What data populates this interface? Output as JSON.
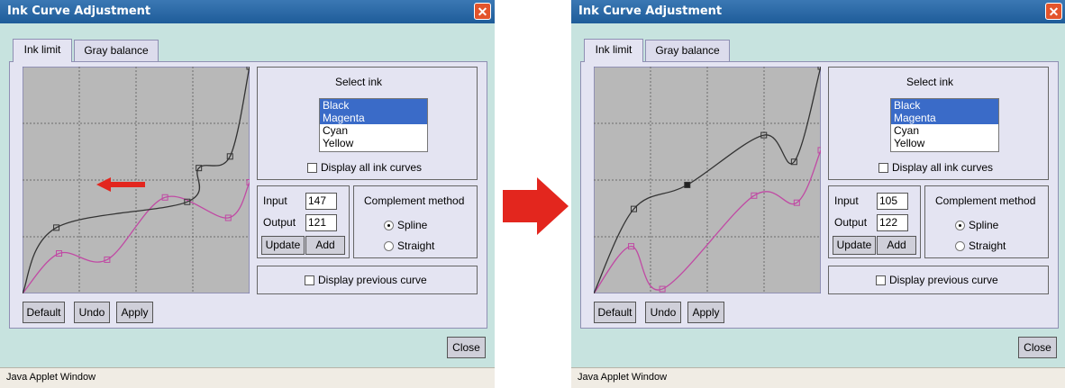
{
  "colors": {
    "window_bg": "#c7e3df",
    "title_bar": "#1e5c99",
    "panel_bg": "#e4e4f2",
    "graph_bg": "#b8b8b8",
    "black_curve": "#333333",
    "magenta_curve": "#c04aa4",
    "selection": "#3a6bc8",
    "transition_arrow": "#e3261e"
  },
  "icons": {
    "close": "close-x-icon",
    "arrow": "right-arrow-icon",
    "drag": "left-arrow-icon"
  },
  "before": {
    "title": "Ink Curve Adjustment",
    "close_glyph": "✕",
    "tabs": [
      "Ink limit",
      "Gray balance"
    ],
    "select_ink_label": "Select ink",
    "inks": [
      {
        "label": "Black",
        "selected": true
      },
      {
        "label": "Magenta",
        "selected": true
      },
      {
        "label": "Cyan",
        "selected": false
      },
      {
        "label": "Yellow",
        "selected": false
      }
    ],
    "display_all_label": "Display all ink curves",
    "input_label": "Input",
    "input_value": "147",
    "output_label": "Output",
    "output_value": "121",
    "update_label": "Update",
    "add_label": "Add",
    "complement_label": "Complement method",
    "spline_label": "Spline",
    "straight_label": "Straight",
    "complement_selected": "Spline",
    "display_previous_label": "Display previous curve",
    "default_label": "Default",
    "undo_label": "Undo",
    "apply_label": "Apply",
    "close_label": "Close",
    "status_text": "Java Applet Window",
    "curves": {
      "black": [
        [
          0,
          0
        ],
        [
          38,
          74
        ],
        [
          185,
          103
        ],
        [
          198,
          141
        ],
        [
          233,
          154
        ],
        [
          255,
          255
        ]
      ],
      "magenta": [
        [
          0,
          0
        ],
        [
          41,
          45
        ],
        [
          95,
          38
        ],
        [
          160,
          108
        ],
        [
          231,
          85
        ],
        [
          255,
          125
        ]
      ]
    }
  },
  "after": {
    "title": "Ink Curve Adjustment",
    "close_glyph": "✕",
    "tabs": [
      "Ink limit",
      "Gray balance"
    ],
    "select_ink_label": "Select ink",
    "inks": [
      {
        "label": "Black",
        "selected": true
      },
      {
        "label": "Magenta",
        "selected": true
      },
      {
        "label": "Cyan",
        "selected": false
      },
      {
        "label": "Yellow",
        "selected": false
      }
    ],
    "display_all_label": "Display all ink curves",
    "input_label": "Input",
    "input_value": "105",
    "output_label": "Output",
    "output_value": "122",
    "update_label": "Update",
    "add_label": "Add",
    "complement_label": "Complement method",
    "spline_label": "Spline",
    "straight_label": "Straight",
    "complement_selected": "Spline",
    "display_previous_label": "Display previous curve",
    "default_label": "Default",
    "undo_label": "Undo",
    "apply_label": "Apply",
    "close_label": "Close",
    "status_text": "Java Applet Window",
    "curves": {
      "black": [
        [
          0,
          0
        ],
        [
          45,
          95
        ],
        [
          105,
          122
        ],
        [
          191,
          178
        ],
        [
          225,
          148
        ],
        [
          255,
          255
        ]
      ],
      "magenta": [
        [
          0,
          0
        ],
        [
          42,
          53
        ],
        [
          77,
          5
        ],
        [
          180,
          110
        ],
        [
          228,
          102
        ],
        [
          255,
          161
        ]
      ]
    }
  }
}
